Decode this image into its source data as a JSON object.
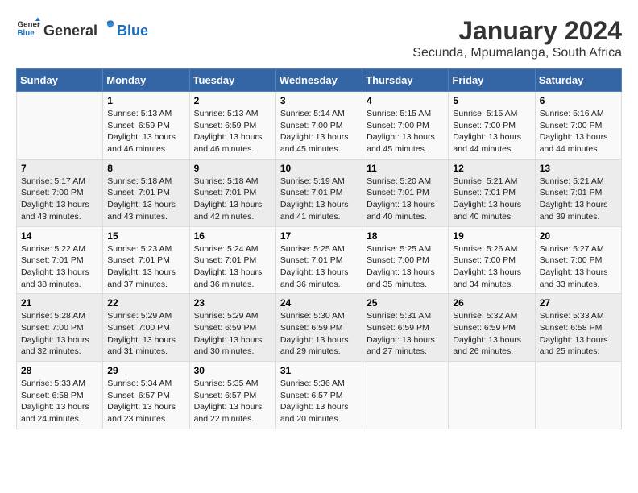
{
  "header": {
    "logo_general": "General",
    "logo_blue": "Blue",
    "title": "January 2024",
    "subtitle": "Secunda, Mpumalanga, South Africa"
  },
  "calendar": {
    "days_of_week": [
      "Sunday",
      "Monday",
      "Tuesday",
      "Wednesday",
      "Thursday",
      "Friday",
      "Saturday"
    ],
    "weeks": [
      [
        {
          "day": "",
          "info": ""
        },
        {
          "day": "1",
          "info": "Sunrise: 5:13 AM\nSunset: 6:59 PM\nDaylight: 13 hours\nand 46 minutes."
        },
        {
          "day": "2",
          "info": "Sunrise: 5:13 AM\nSunset: 6:59 PM\nDaylight: 13 hours\nand 46 minutes."
        },
        {
          "day": "3",
          "info": "Sunrise: 5:14 AM\nSunset: 7:00 PM\nDaylight: 13 hours\nand 45 minutes."
        },
        {
          "day": "4",
          "info": "Sunrise: 5:15 AM\nSunset: 7:00 PM\nDaylight: 13 hours\nand 45 minutes."
        },
        {
          "day": "5",
          "info": "Sunrise: 5:15 AM\nSunset: 7:00 PM\nDaylight: 13 hours\nand 44 minutes."
        },
        {
          "day": "6",
          "info": "Sunrise: 5:16 AM\nSunset: 7:00 PM\nDaylight: 13 hours\nand 44 minutes."
        }
      ],
      [
        {
          "day": "7",
          "info": "Sunrise: 5:17 AM\nSunset: 7:00 PM\nDaylight: 13 hours\nand 43 minutes."
        },
        {
          "day": "8",
          "info": "Sunrise: 5:18 AM\nSunset: 7:01 PM\nDaylight: 13 hours\nand 43 minutes."
        },
        {
          "day": "9",
          "info": "Sunrise: 5:18 AM\nSunset: 7:01 PM\nDaylight: 13 hours\nand 42 minutes."
        },
        {
          "day": "10",
          "info": "Sunrise: 5:19 AM\nSunset: 7:01 PM\nDaylight: 13 hours\nand 41 minutes."
        },
        {
          "day": "11",
          "info": "Sunrise: 5:20 AM\nSunset: 7:01 PM\nDaylight: 13 hours\nand 40 minutes."
        },
        {
          "day": "12",
          "info": "Sunrise: 5:21 AM\nSunset: 7:01 PM\nDaylight: 13 hours\nand 40 minutes."
        },
        {
          "day": "13",
          "info": "Sunrise: 5:21 AM\nSunset: 7:01 PM\nDaylight: 13 hours\nand 39 minutes."
        }
      ],
      [
        {
          "day": "14",
          "info": "Sunrise: 5:22 AM\nSunset: 7:01 PM\nDaylight: 13 hours\nand 38 minutes."
        },
        {
          "day": "15",
          "info": "Sunrise: 5:23 AM\nSunset: 7:01 PM\nDaylight: 13 hours\nand 37 minutes."
        },
        {
          "day": "16",
          "info": "Sunrise: 5:24 AM\nSunset: 7:01 PM\nDaylight: 13 hours\nand 36 minutes."
        },
        {
          "day": "17",
          "info": "Sunrise: 5:25 AM\nSunset: 7:01 PM\nDaylight: 13 hours\nand 36 minutes."
        },
        {
          "day": "18",
          "info": "Sunrise: 5:25 AM\nSunset: 7:00 PM\nDaylight: 13 hours\nand 35 minutes."
        },
        {
          "day": "19",
          "info": "Sunrise: 5:26 AM\nSunset: 7:00 PM\nDaylight: 13 hours\nand 34 minutes."
        },
        {
          "day": "20",
          "info": "Sunrise: 5:27 AM\nSunset: 7:00 PM\nDaylight: 13 hours\nand 33 minutes."
        }
      ],
      [
        {
          "day": "21",
          "info": "Sunrise: 5:28 AM\nSunset: 7:00 PM\nDaylight: 13 hours\nand 32 minutes."
        },
        {
          "day": "22",
          "info": "Sunrise: 5:29 AM\nSunset: 7:00 PM\nDaylight: 13 hours\nand 31 minutes."
        },
        {
          "day": "23",
          "info": "Sunrise: 5:29 AM\nSunset: 6:59 PM\nDaylight: 13 hours\nand 30 minutes."
        },
        {
          "day": "24",
          "info": "Sunrise: 5:30 AM\nSunset: 6:59 PM\nDaylight: 13 hours\nand 29 minutes."
        },
        {
          "day": "25",
          "info": "Sunrise: 5:31 AM\nSunset: 6:59 PM\nDaylight: 13 hours\nand 27 minutes."
        },
        {
          "day": "26",
          "info": "Sunrise: 5:32 AM\nSunset: 6:59 PM\nDaylight: 13 hours\nand 26 minutes."
        },
        {
          "day": "27",
          "info": "Sunrise: 5:33 AM\nSunset: 6:58 PM\nDaylight: 13 hours\nand 25 minutes."
        }
      ],
      [
        {
          "day": "28",
          "info": "Sunrise: 5:33 AM\nSunset: 6:58 PM\nDaylight: 13 hours\nand 24 minutes."
        },
        {
          "day": "29",
          "info": "Sunrise: 5:34 AM\nSunset: 6:57 PM\nDaylight: 13 hours\nand 23 minutes."
        },
        {
          "day": "30",
          "info": "Sunrise: 5:35 AM\nSunset: 6:57 PM\nDaylight: 13 hours\nand 22 minutes."
        },
        {
          "day": "31",
          "info": "Sunrise: 5:36 AM\nSunset: 6:57 PM\nDaylight: 13 hours\nand 20 minutes."
        },
        {
          "day": "",
          "info": ""
        },
        {
          "day": "",
          "info": ""
        },
        {
          "day": "",
          "info": ""
        }
      ]
    ]
  }
}
